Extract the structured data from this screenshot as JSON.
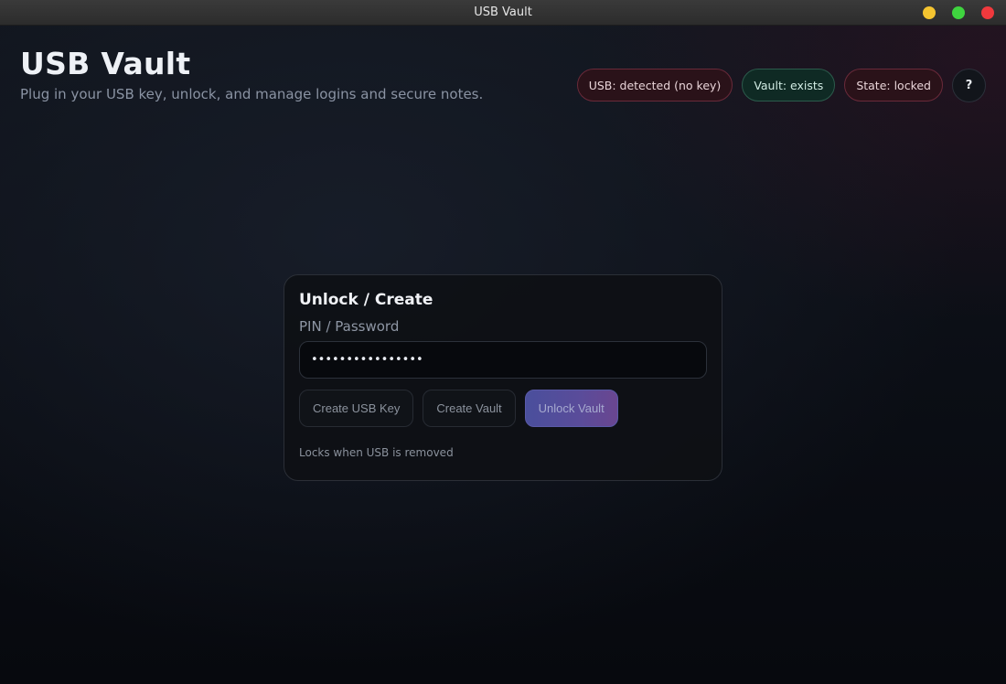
{
  "window": {
    "title": "USB Vault",
    "controls": [
      "minimize",
      "maximize",
      "close"
    ]
  },
  "header": {
    "title": "USB Vault",
    "subtitle": "Plug in your USB key, unlock, and manage logins and secure notes."
  },
  "status": {
    "usb": "USB: detected (no key)",
    "vault": "Vault: exists",
    "state": "State: locked",
    "help_label": "?"
  },
  "card": {
    "title": "Unlock / Create",
    "field_label": "PIN / Password",
    "password_value": "••••••••••••••••",
    "buttons": {
      "create_key": "Create USB Key",
      "create_vault": "Create Vault",
      "unlock": "Unlock Vault"
    },
    "note": "Locks when USB is removed"
  },
  "colors": {
    "status_bad": "#2a1219",
    "status_good": "#0f2a24",
    "accent_gradient_start": "#4a4f9c",
    "accent_gradient_end": "#6a4690"
  }
}
